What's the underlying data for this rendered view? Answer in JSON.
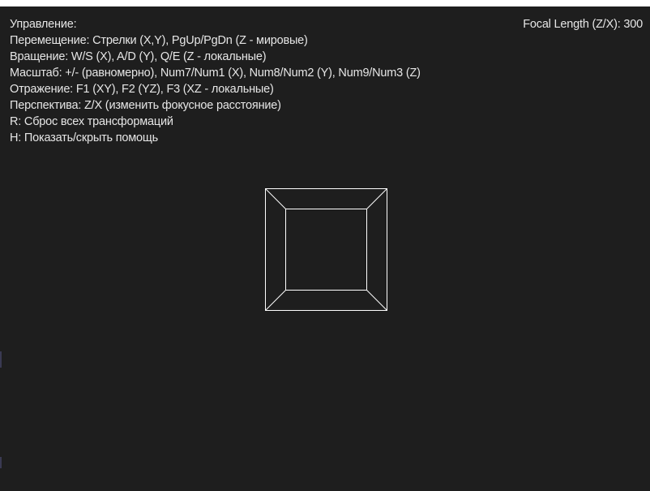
{
  "help": {
    "title": "Управление:",
    "lines": [
      "Перемещение: Стрелки (X,Y), PgUp/PgDn (Z - мировые)",
      "Вращение: W/S (X), A/D (Y), Q/E (Z - локальные)",
      "Масштаб: +/- (равномерно), Num7/Num1 (X), Num8/Num2 (Y), Num9/Num3 (Z)",
      "Отражение: F1 (XY), F2 (YZ), F3 (XZ - локальные)",
      "Перспектива: Z/X (изменить фокусное расстояние)",
      "R: Сброс всех трансформаций",
      "H: Показать/скрыть помощь"
    ]
  },
  "focal": {
    "label": "Focal Length (Z/X):",
    "value": "300"
  },
  "colors": {
    "background": "#1e1e1e",
    "text": "#e6e6e6",
    "wireframe": "#ffffff"
  }
}
